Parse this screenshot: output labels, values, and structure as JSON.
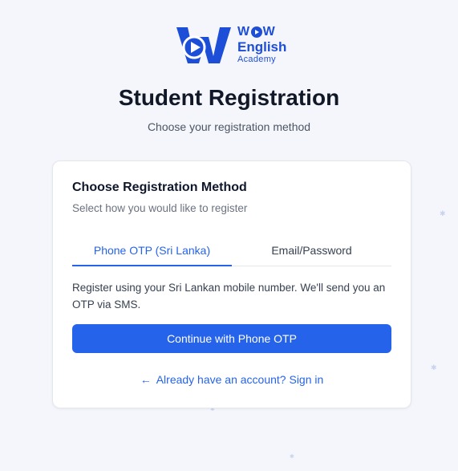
{
  "logo": {
    "wow_prefix": "W",
    "wow_suffix": "W",
    "english": "English",
    "academy": "Academy",
    "brand_color": "#1d4ed8"
  },
  "header": {
    "title": "Student Registration",
    "subtitle": "Choose your registration method"
  },
  "card": {
    "title": "Choose Registration Method",
    "description": "Select how you would like to register",
    "tabs": [
      {
        "label": "Phone OTP (Sri Lanka)",
        "active": true
      },
      {
        "label": "Email/Password",
        "active": false
      }
    ],
    "body_text": "Register using your Sri Lankan mobile number. We'll send you an OTP via SMS.",
    "primary_button": "Continue with Phone OTP",
    "signin_arrow": "←",
    "signin_link": "Already have an account? Sign in"
  },
  "colors": {
    "accent": "#2563eb",
    "background": "#f5f6fb"
  }
}
